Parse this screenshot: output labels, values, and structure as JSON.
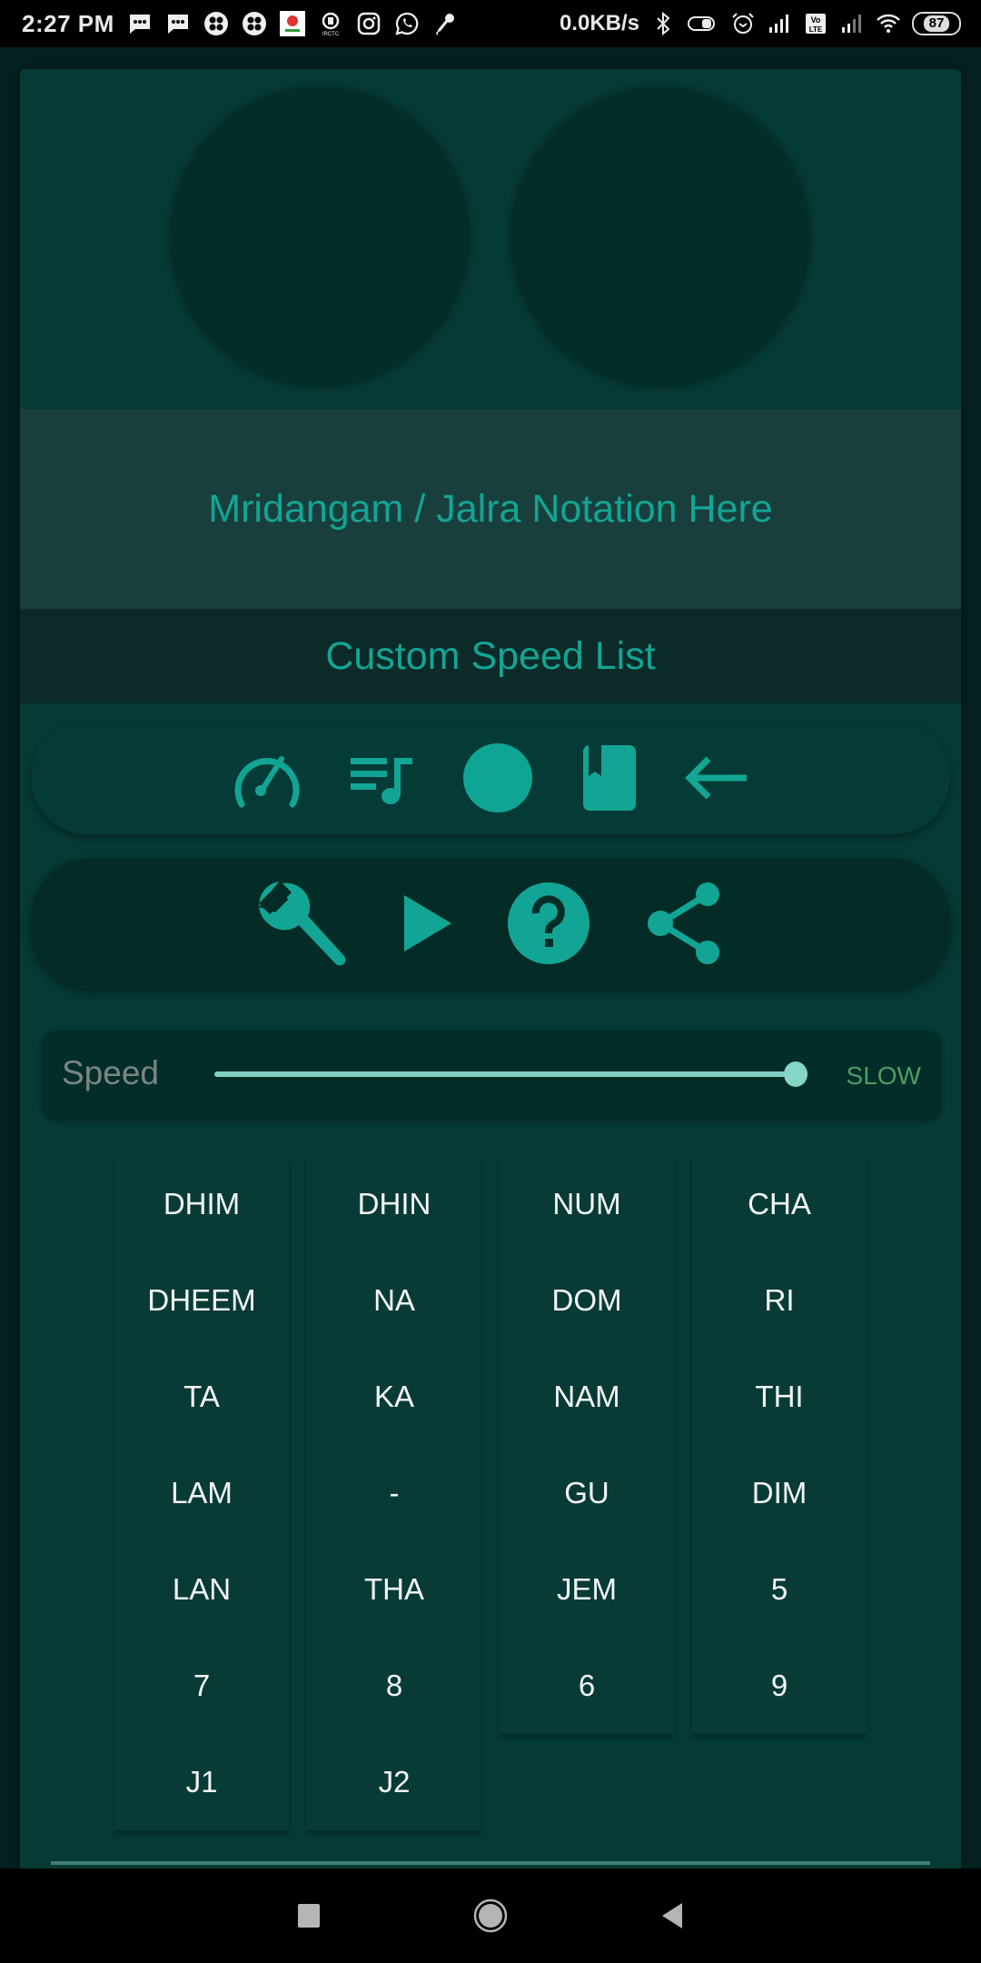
{
  "status_bar": {
    "time": "2:27 PM",
    "network_speed": "0.0KB/s",
    "battery_level": "87",
    "left_icons": [
      "message-icon",
      "message-icon",
      "app-icon",
      "app-icon",
      "app-logo-icon",
      "irctc-icon",
      "instagram-icon",
      "whatsapp-icon",
      "microphone-icon"
    ],
    "right_icons": [
      "bluetooth-icon",
      "toggle-icon",
      "alarm-icon",
      "signal-icon",
      "volte-icon",
      "signal-icon",
      "wifi-icon",
      "battery-icon"
    ]
  },
  "drums": {
    "left": "left-drum-pad",
    "right": "right-drum-pad"
  },
  "notation": {
    "text": "Mridangam / Jalra Notation Here"
  },
  "speed_list": {
    "label": "Custom Speed List"
  },
  "toolbar_primary": [
    {
      "icon": "speedometer-icon",
      "name": "speed-button"
    },
    {
      "icon": "playlist-music-icon",
      "name": "playlist-button"
    },
    {
      "icon": "record-icon",
      "name": "record-button"
    },
    {
      "icon": "bookmark-book-icon",
      "name": "bookmark-button"
    },
    {
      "icon": "arrow-back-icon",
      "name": "backspace-button"
    }
  ],
  "toolbar_secondary": [
    {
      "icon": "wrench-icon",
      "name": "settings-button"
    },
    {
      "icon": "play-icon",
      "name": "play-button"
    },
    {
      "icon": "help-icon",
      "name": "help-button"
    },
    {
      "icon": "share-icon",
      "name": "share-button"
    }
  ],
  "speed": {
    "label": "Speed",
    "value_label": "SLOW",
    "slider_fraction": 1.0
  },
  "pads": {
    "columns": [
      [
        "DHIM",
        "DHEEM",
        "TA",
        "LAM",
        "LAN",
        "7",
        "J1"
      ],
      [
        "DHIN",
        "NA",
        "KA",
        "-",
        "THA",
        "8",
        "J2"
      ],
      [
        "NUM",
        "DOM",
        "NAM",
        "GU",
        "JEM",
        "6"
      ],
      [
        "CHA",
        "RI",
        "THI",
        "DIM",
        "5",
        "9"
      ]
    ]
  },
  "colors": {
    "accent": "#12a596",
    "panel": "#063a35",
    "drum": "#032e28",
    "slider": "#86d5c8",
    "slow_text": "#4f9d63"
  },
  "nav_bar": {
    "buttons": [
      "recents-button",
      "home-button",
      "back-button"
    ]
  }
}
